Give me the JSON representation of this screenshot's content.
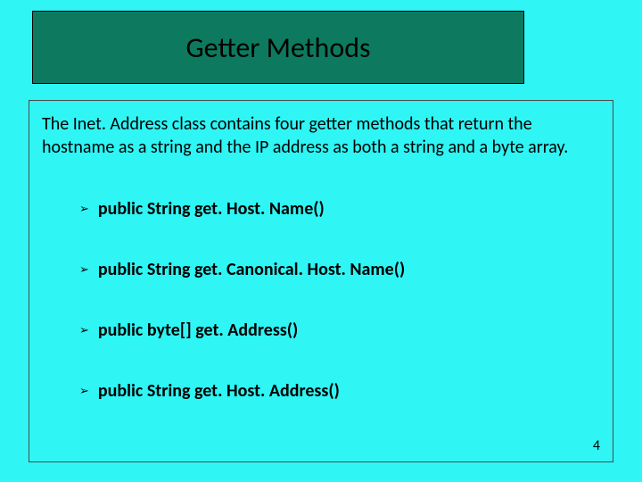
{
  "title": "Getter Methods",
  "intro": "The Inet. Address class contains four getter methods that return the hostname as a string and the IP address as both a string and a byte array.",
  "bullets": [
    "public String get. Host. Name()",
    "public String get. Canonical. Host. Name()",
    "public byte[] get. Address()",
    "public String get. Host. Address()"
  ],
  "page_number": "4"
}
